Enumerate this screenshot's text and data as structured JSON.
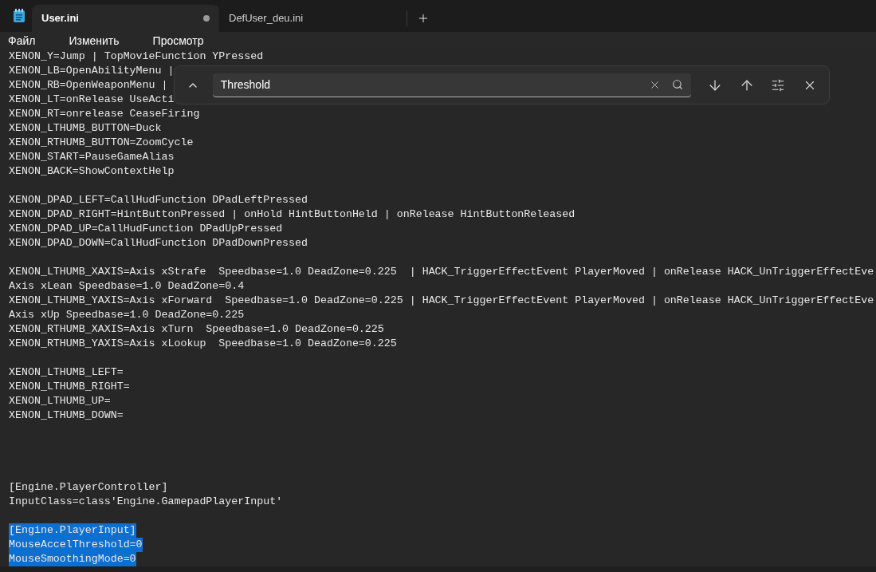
{
  "tabs": [
    {
      "label": "User.ini",
      "selected": true,
      "modified": true
    },
    {
      "label": "DefUser_deu.ini",
      "selected": false,
      "modified": false
    }
  ],
  "menu": [
    "Файл",
    "Изменить",
    "Просмотр"
  ],
  "find": {
    "value": "Threshold"
  },
  "lines": [
    {
      "kind": "text",
      "text": "XENON_Y=Jump | TopMovieFunction YPressed",
      "selected": false
    },
    {
      "kind": "text",
      "text": "XENON_LB=OpenAbilityMenu |",
      "selected": false
    },
    {
      "kind": "text",
      "text": "XENON_RB=OpenWeaponMenu |",
      "selected": false
    },
    {
      "kind": "text",
      "text": "XENON_LT=onRelease UseActi",
      "selected": false
    },
    {
      "kind": "text",
      "text": "XENON_RT=onrelease CeaseFiring",
      "selected": false
    },
    {
      "kind": "text",
      "text": "XENON_LTHUMB_BUTTON=Duck",
      "selected": false
    },
    {
      "kind": "text",
      "text": "XENON_RTHUMB_BUTTON=ZoomCycle",
      "selected": false
    },
    {
      "kind": "text",
      "text": "XENON_START=PauseGameAlias",
      "selected": false
    },
    {
      "kind": "text",
      "text": "XENON_BACK=ShowContextHelp",
      "selected": false
    },
    {
      "kind": "blank"
    },
    {
      "kind": "text",
      "text": "XENON_DPAD_LEFT=CallHudFunction DPadLeftPressed",
      "selected": false
    },
    {
      "kind": "text",
      "text": "XENON_DPAD_RIGHT=HintButtonPressed | onHold HintButtonHeld | onRelease HintButtonReleased",
      "selected": false
    },
    {
      "kind": "text",
      "text": "XENON_DPAD_UP=CallHudFunction DPadUpPressed",
      "selected": false
    },
    {
      "kind": "text",
      "text": "XENON_DPAD_DOWN=CallHudFunction DPadDownPressed",
      "selected": false
    },
    {
      "kind": "blank"
    },
    {
      "kind": "text",
      "text": "XENON_LTHUMB_XAXIS=Axis xStrafe  Speedbase=1.0 DeadZone=0.225  | HACK_TriggerEffectEvent PlayerMoved | onRelease HACK_UnTriggerEffectEve",
      "selected": false
    },
    {
      "kind": "text",
      "text": "Axis xLean Speedbase=1.0 DeadZone=0.4",
      "selected": false
    },
    {
      "kind": "text",
      "text": "XENON_LTHUMB_YAXIS=Axis xForward  Speedbase=1.0 DeadZone=0.225 | HACK_TriggerEffectEvent PlayerMoved | onRelease HACK_UnTriggerEffectEve",
      "selected": false
    },
    {
      "kind": "text",
      "text": "Axis xUp Speedbase=1.0 DeadZone=0.225",
      "selected": false
    },
    {
      "kind": "text",
      "text": "XENON_RTHUMB_XAXIS=Axis xTurn  Speedbase=1.0 DeadZone=0.225",
      "selected": false
    },
    {
      "kind": "text",
      "text": "XENON_RTHUMB_YAXIS=Axis xLookup  Speedbase=1.0 DeadZone=0.225",
      "selected": false
    },
    {
      "kind": "blank"
    },
    {
      "kind": "text",
      "text": "XENON_LTHUMB_LEFT=",
      "selected": false
    },
    {
      "kind": "text",
      "text": "XENON_LTHUMB_RIGHT=",
      "selected": false
    },
    {
      "kind": "text",
      "text": "XENON_LTHUMB_UP=",
      "selected": false
    },
    {
      "kind": "text",
      "text": "XENON_LTHUMB_DOWN=",
      "selected": false
    },
    {
      "kind": "blank"
    },
    {
      "kind": "blank"
    },
    {
      "kind": "blank"
    },
    {
      "kind": "blank"
    },
    {
      "kind": "text",
      "text": "[Engine.PlayerController]",
      "selected": false
    },
    {
      "kind": "text",
      "text": "InputClass=class'Engine.GamepadPlayerInput'",
      "selected": false
    },
    {
      "kind": "blank"
    },
    {
      "kind": "text",
      "text": "[Engine.PlayerInput]",
      "selected": true
    },
    {
      "kind": "text",
      "text": "MouseAccelThreshold=0",
      "selected": true
    },
    {
      "kind": "text",
      "text": "MouseSmoothingMode=0",
      "selected": true
    }
  ]
}
